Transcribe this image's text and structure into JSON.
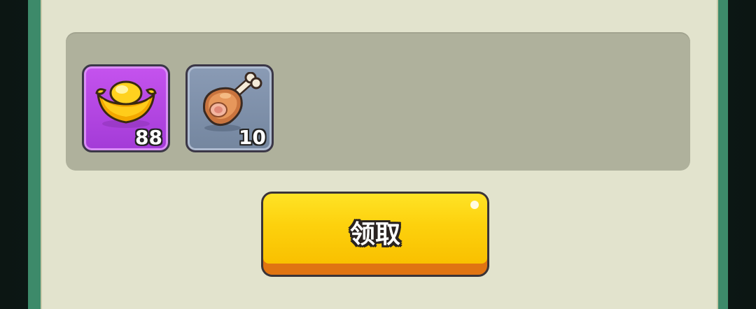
{
  "rewards": {
    "items": [
      {
        "icon": "gold-ingot-icon",
        "count": "88",
        "rarity_color": "#b446e2"
      },
      {
        "icon": "meat-drumstick-icon",
        "count": "10",
        "rarity_color": "#7f90aa"
      }
    ]
  },
  "claim_button": {
    "label": "领取",
    "color": "#fdd10d"
  },
  "colors": {
    "panel": "#e2e3cd",
    "frame": "#3d8a6a",
    "reward_box": "#afb19c"
  }
}
